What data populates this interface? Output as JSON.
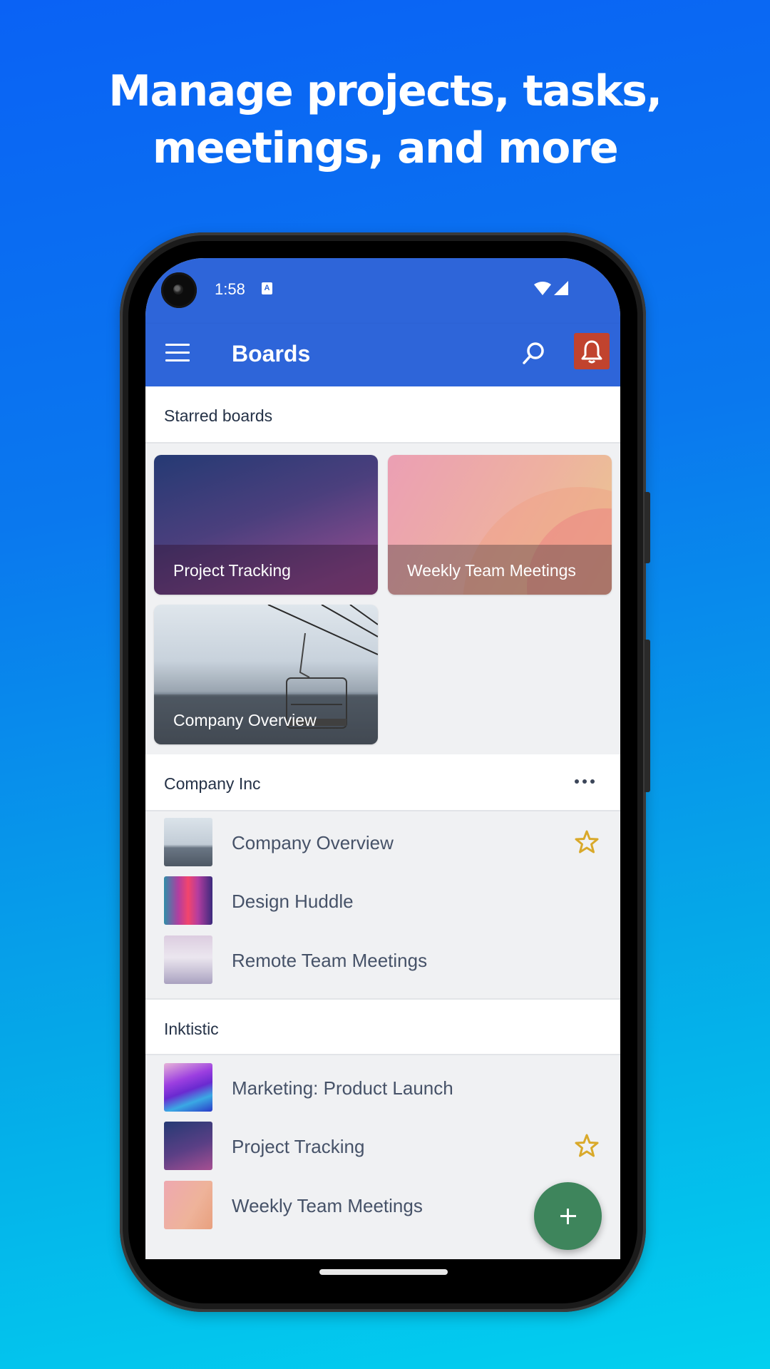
{
  "promo": {
    "headline_line1": "Manage projects, tasks,",
    "headline_line2": "meetings, and more"
  },
  "status_bar": {
    "time": "1:58",
    "notification_icon": "a-icon",
    "notification_glyph": "A",
    "wifi_icon": "wifi-icon",
    "signal_icon": "signal-icon"
  },
  "app_bar": {
    "title": "Boards",
    "menu_icon": "menu-icon",
    "search_icon": "search-icon",
    "notification_icon": "bell-icon",
    "notification_bg_color": "#c1432e"
  },
  "starred": {
    "header": "Starred boards",
    "tiles": [
      {
        "title": "Project Tracking"
      },
      {
        "title": "Weekly Team Meetings"
      },
      {
        "title": "Company Overview"
      }
    ]
  },
  "workspaces": [
    {
      "name": "Company Inc",
      "more_icon": "more-horizontal-icon",
      "boards": [
        {
          "name": "Company Overview",
          "starred": true
        },
        {
          "name": "Design Huddle",
          "starred": false
        },
        {
          "name": "Remote Team Meetings",
          "starred": false
        }
      ]
    },
    {
      "name": "Inktistic",
      "boards": [
        {
          "name": "Marketing: Product Launch",
          "starred": false
        },
        {
          "name": "Project Tracking",
          "starred": true
        },
        {
          "name": "Weekly Team Meetings",
          "starred": false
        }
      ]
    }
  ],
  "fab": {
    "icon": "plus-icon"
  },
  "colors": {
    "brand_blue": "#2e65d9",
    "star_gold": "#d9a92a",
    "fab_green": "#3e855c"
  }
}
